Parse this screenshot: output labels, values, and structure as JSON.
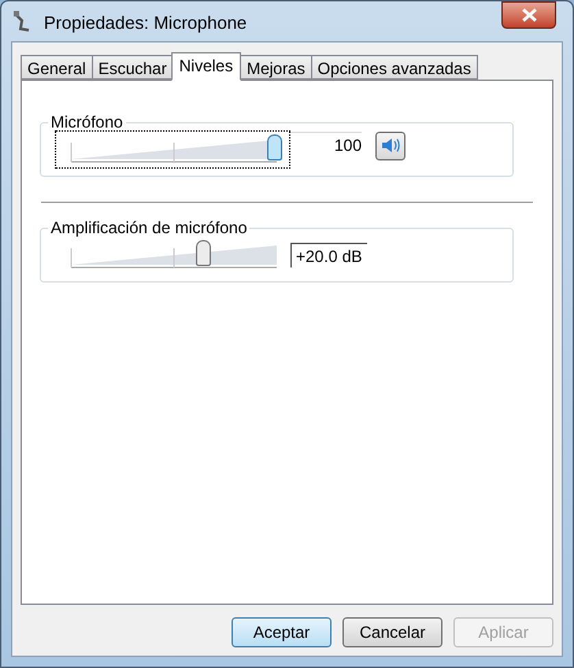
{
  "window": {
    "title": "Propiedades: Microphone"
  },
  "tabs": [
    {
      "label": "General",
      "selected": false
    },
    {
      "label": "Escuchar",
      "selected": false
    },
    {
      "label": "Niveles",
      "selected": true
    },
    {
      "label": "Mejoras",
      "selected": false
    },
    {
      "label": "Opciones avanzadas",
      "selected": false
    }
  ],
  "groups": [
    {
      "label": "Micrófono",
      "level": 1.0,
      "reading": "100",
      "focused": true,
      "has_mute_button": true
    },
    {
      "label": "Amplificación de micrófono",
      "level": 0.65,
      "reading": "+20.0 dB",
      "focused": false,
      "has_mute_button": false
    }
  ],
  "buttons": [
    {
      "label": "Aceptar",
      "default": true,
      "disabled": false
    },
    {
      "label": "Cancelar",
      "default": false,
      "disabled": false
    },
    {
      "label": "Aplicar",
      "default": false,
      "disabled": true
    }
  ]
}
